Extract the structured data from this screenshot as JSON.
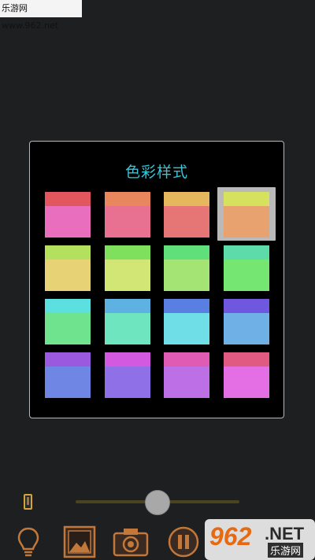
{
  "watermark": {
    "top_text": "乐游网 www.962.net",
    "bottom_num": "962",
    "bottom_net": ".NET",
    "bottom_cn": "乐游网"
  },
  "dialog": {
    "title": "色彩样式"
  },
  "swatches": [
    {
      "top": "#e2575e",
      "bottom": "#e96fbe"
    },
    {
      "top": "#e8875e",
      "bottom": "#e87090"
    },
    {
      "top": "#e6b85e",
      "bottom": "#e57675"
    },
    {
      "top": "#d6e15d",
      "bottom": "#e8a26f"
    },
    {
      "top": "#b3e05d",
      "bottom": "#e7d276"
    },
    {
      "top": "#7ee05c",
      "bottom": "#d2e675"
    },
    {
      "top": "#5fe07a",
      "bottom": "#a3e475"
    },
    {
      "top": "#5ddcaa",
      "bottom": "#76e673"
    },
    {
      "top": "#5cdfdf",
      "bottom": "#6fe38e"
    },
    {
      "top": "#5eb2e2",
      "bottom": "#6fe5bf"
    },
    {
      "top": "#5a7fe3",
      "bottom": "#6fdee6"
    },
    {
      "top": "#6f57e0",
      "bottom": "#6fb0e6"
    },
    {
      "top": "#9b59e0",
      "bottom": "#6f86e5"
    },
    {
      "top": "#d35ae0",
      "bottom": "#8f70e6"
    },
    {
      "top": "#e05bb4",
      "bottom": "#bd70e6"
    },
    {
      "top": "#e05a82",
      "bottom": "#e46fe4"
    }
  ],
  "selected_index": 3,
  "slider": {
    "value": 0.5
  },
  "toolbar": [
    "bulb-icon",
    "gallery-icon",
    "camera-icon",
    "pause-icon"
  ]
}
